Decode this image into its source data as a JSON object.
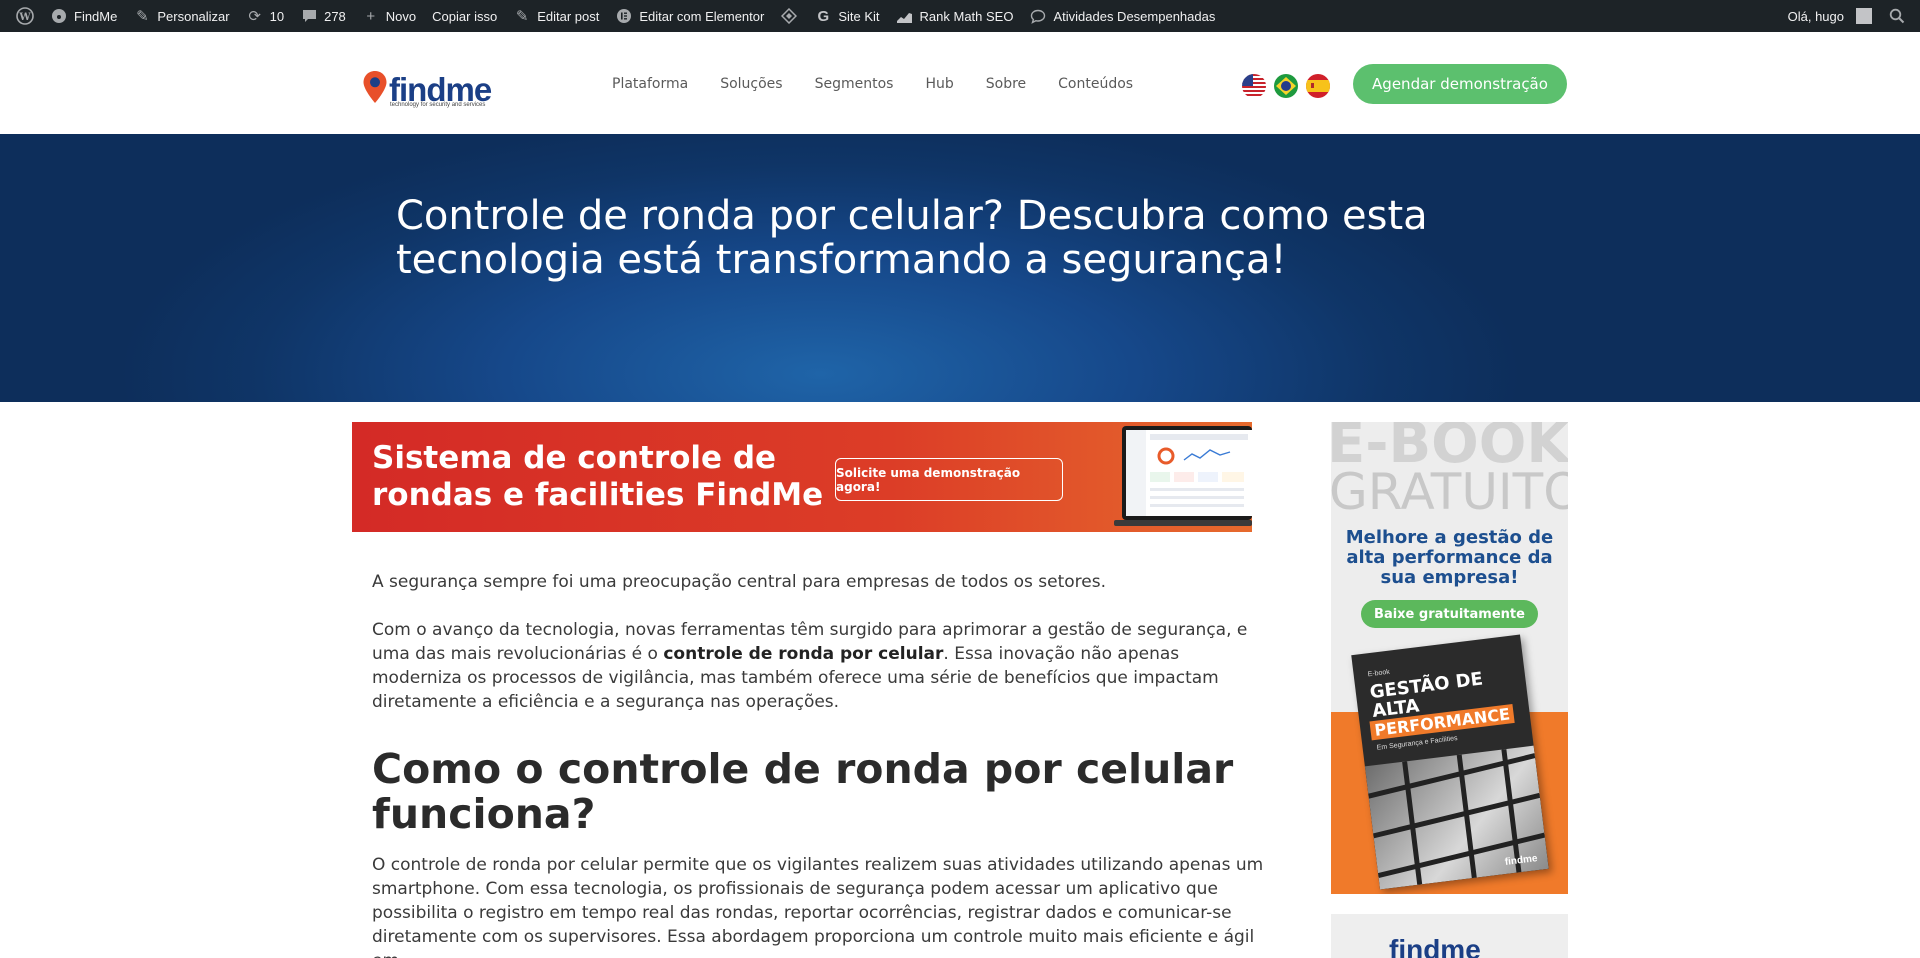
{
  "adminbar": {
    "items": [
      {
        "icon": "wordpress-icon",
        "label": ""
      },
      {
        "icon": "dashboard-icon",
        "label": "FindMe"
      },
      {
        "icon": "brush-icon",
        "label": "Personalizar"
      },
      {
        "icon": "updates-icon",
        "label": "10"
      },
      {
        "icon": "comments-icon",
        "label": "278"
      },
      {
        "icon": "plus-icon",
        "label": "Novo"
      },
      {
        "icon": "",
        "label": "Copiar isso"
      },
      {
        "icon": "pencil-icon",
        "label": "Editar post"
      },
      {
        "icon": "elementor-icon",
        "label": "Editar com Elementor"
      },
      {
        "icon": "diamond-icon",
        "label": ""
      },
      {
        "icon": "google-icon",
        "label": "Site Kit"
      },
      {
        "icon": "rankmath-icon",
        "label": "Rank Math SEO"
      },
      {
        "icon": "activity-icon",
        "label": "Atividades Desempenhadas"
      }
    ],
    "greeting": "Olá, hugo"
  },
  "header": {
    "logo_text": "findme",
    "logo_tagline": "technology for security and services",
    "nav": [
      "Plataforma",
      "Soluções",
      "Segmentos",
      "Hub",
      "Sobre",
      "Conteúdos"
    ],
    "flags": [
      "us-flag-icon",
      "brazil-flag-icon",
      "spain-flag-icon"
    ],
    "cta": "Agendar demonstração"
  },
  "hero": {
    "title": "Controle de ronda por celular? Descubra como esta tecnologia está transformando a segurança!"
  },
  "banner": {
    "title": "Sistema de controle de rondas e facilities FindMe",
    "button": "Solicite uma demonstração agora!"
  },
  "article": {
    "p1": "A segurança sempre foi uma preocupação central para empresas de todos os setores.",
    "p2_before": "Com o avanço da tecnologia, novas ferramentas têm surgido para aprimorar a gestão de segurança, e uma das mais revolucionárias é o ",
    "p2_bold": "controle de ronda por celular",
    "p2_after": ". Essa inovação não apenas moderniza os processos de vigilância, mas também oferece uma série de benefícios que impactam diretamente a eficiência e a segurança nas operações.",
    "h2": "Como o controle de ronda por celular funciona?",
    "p3": "O controle de ronda por celular permite que os vigilantes realizem suas atividades utilizando apenas um smartphone. Com essa tecnologia, os profissionais de segurança podem acessar um aplicativo que possibilita o registro em tempo real das rondas, reportar ocorrências, registrar dados e comunicar-se diretamente com os supervisores. Essa abordagem proporciona um controle muito mais eficiente e ágil em"
  },
  "sidebar": {
    "ebook_big1": "E-BOOK",
    "ebook_big2": "GRATUITO",
    "ebook_headline": "Melhore a gestão de alta performance da sua empresa!",
    "ebook_button": "Baixe gratuitamente",
    "book_small": "E-book",
    "book_title": "GESTÃO DE ALTA",
    "book_title_highlight": "PERFORMANCE",
    "book_subtitle": "Em Segurança e Facilities",
    "book_brand": "findme",
    "second_logo": "findme"
  }
}
